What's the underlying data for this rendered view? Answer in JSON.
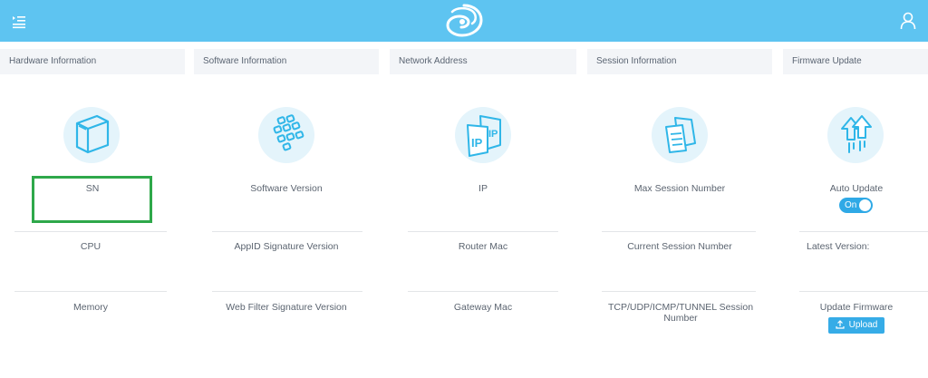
{
  "topbar": {
    "color": "#5ec4f1"
  },
  "panels": [
    {
      "header": "Hardware Information",
      "items": [
        "SN",
        "CPU",
        "Memory"
      ],
      "icon": "chassis-icon"
    },
    {
      "header": "Software Information",
      "items": [
        "Software Version",
        "AppID Signature Version",
        "Web Filter Signature Version"
      ],
      "icon": "app-grid-icon"
    },
    {
      "header": "Network Address",
      "items": [
        "IP",
        "Router Mac",
        "Gateway Mac"
      ],
      "icon": "ip-icon"
    },
    {
      "header": "Session Information",
      "items": [
        "Max Session Number",
        "Current Session Number",
        "TCP/UDP/ICMP/TUNNEL Session Number"
      ],
      "icon": "session-stack-icon"
    },
    {
      "header": "Firmware Update",
      "items": [
        "Auto Update",
        "Latest Version:",
        "Update Firmware"
      ],
      "icon": "upgrade-arrow-icon"
    }
  ],
  "firmware": {
    "toggle_label": "On",
    "toggle_state": true,
    "upload_label": "Upload"
  },
  "colors": {
    "accent": "#36ace7",
    "highlight": "#2ea84a",
    "icon_line": "#2fb6e8",
    "icon_bg": "#e4f4fb"
  }
}
